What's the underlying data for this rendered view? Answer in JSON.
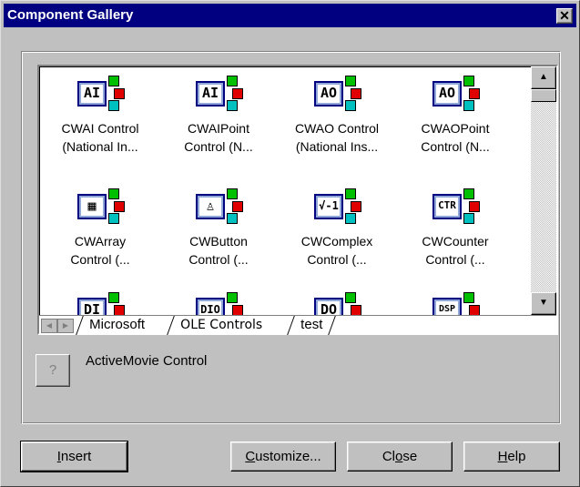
{
  "window": {
    "title": "Component Gallery",
    "close_glyph": "✕"
  },
  "gallery": {
    "items": [
      {
        "label": "CWAI Control\n(National In...",
        "icon_text": "AI",
        "icon": "analog-input-icon"
      },
      {
        "label": "CWAIPoint\nControl (N...",
        "icon_text": "AI",
        "icon": "analog-input-point-icon"
      },
      {
        "label": "CWAO Control\n(National Ins...",
        "icon_text": "AO",
        "icon": "analog-output-icon"
      },
      {
        "label": "CWAOPoint\nControl (N...",
        "icon_text": "AO",
        "icon": "analog-output-point-icon"
      },
      {
        "label": "CWArray\nControl  (...",
        "icon_text": "▦",
        "icon": "array-icon"
      },
      {
        "label": "CWButton\nControl  (...",
        "icon_text": "♙",
        "icon": "button-icon"
      },
      {
        "label": "CWComplex\nControl  (...",
        "icon_text": "√-1",
        "icon": "complex-icon"
      },
      {
        "label": "CWCounter\nControl  (...",
        "icon_text": "CTR",
        "icon": "counter-icon"
      },
      {
        "label": "",
        "icon_text": "DI",
        "icon": "digital-input-icon"
      },
      {
        "label": "",
        "icon_text": "DIO",
        "icon": "digital-io-icon"
      },
      {
        "label": "",
        "icon_text": "DO",
        "icon": "digital-output-icon"
      },
      {
        "label": "",
        "icon_text": "DSP",
        "icon": "dsp-icon"
      }
    ]
  },
  "tabs": [
    {
      "label": "Microsoft",
      "active": false
    },
    {
      "label": "OLE Controls",
      "active": true
    },
    {
      "label": "test",
      "active": false
    }
  ],
  "selection": {
    "help_glyph": "?",
    "name": "ActiveMovie Control"
  },
  "buttons": {
    "insert": {
      "pre": "",
      "u": "I",
      "post": "nsert"
    },
    "customize": {
      "pre": "",
      "u": "C",
      "post": "ustomize..."
    },
    "close": {
      "pre": "Cl",
      "u": "o",
      "post": "se"
    },
    "help": {
      "pre": "",
      "u": "H",
      "post": "elp"
    }
  }
}
